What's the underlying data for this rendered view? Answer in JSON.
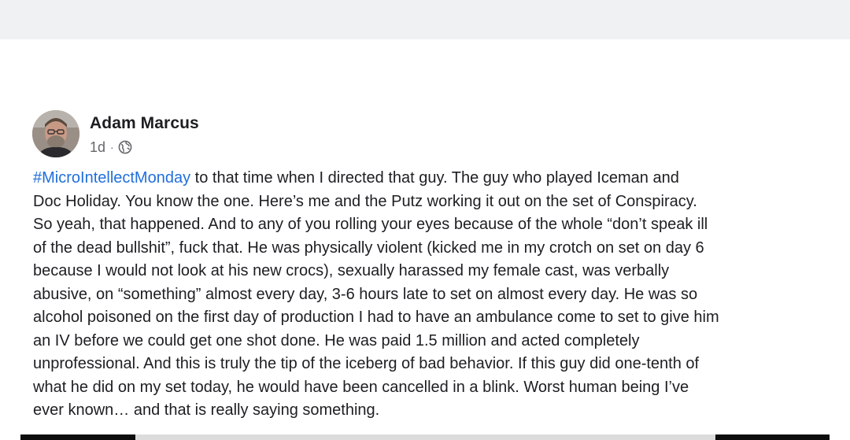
{
  "post": {
    "author": "Adam Marcus",
    "timestamp": "1d",
    "separator": "·",
    "audience_icon": "globe-icon",
    "hashtag": "#MicroIntellectMonday",
    "text_lines": [
      " to that time when I directed that guy.  The guy who played Iceman and",
      "Doc Holiday.  You know the one.  Here’s me and the Putz working it out on the set of Conspiracy.",
      "So yeah, that happened.  And to any of you rolling your eyes because of the whole “don’t speak ill",
      "of the dead bullshit”, fuck that. He was physically violent (kicked me in my crotch on set on day 6",
      "because I would not look at his new crocs), sexually harassed my female cast, was verbally",
      "abusive, on “something” almost every day, 3-6 hours late to set on almost every day.  He was so",
      "alcohol poisoned on the first day of production I had to have an ambulance come to set to give him",
      "an IV before we could get one shot done.  He was paid 1.5 million and acted completely",
      "unprofessional.  And this is truly the tip of the iceberg of bad behavior.  If this guy did one-tenth of",
      "what he did on my set today, he would have been cancelled in a blink.  Worst human being I’ve",
      "ever known… and that is really saying something."
    ]
  },
  "colors": {
    "text": "#1c1e21",
    "secondary_text": "#65676b",
    "hashtag": "#216fdb",
    "top_band": "#f0f1f3"
  }
}
